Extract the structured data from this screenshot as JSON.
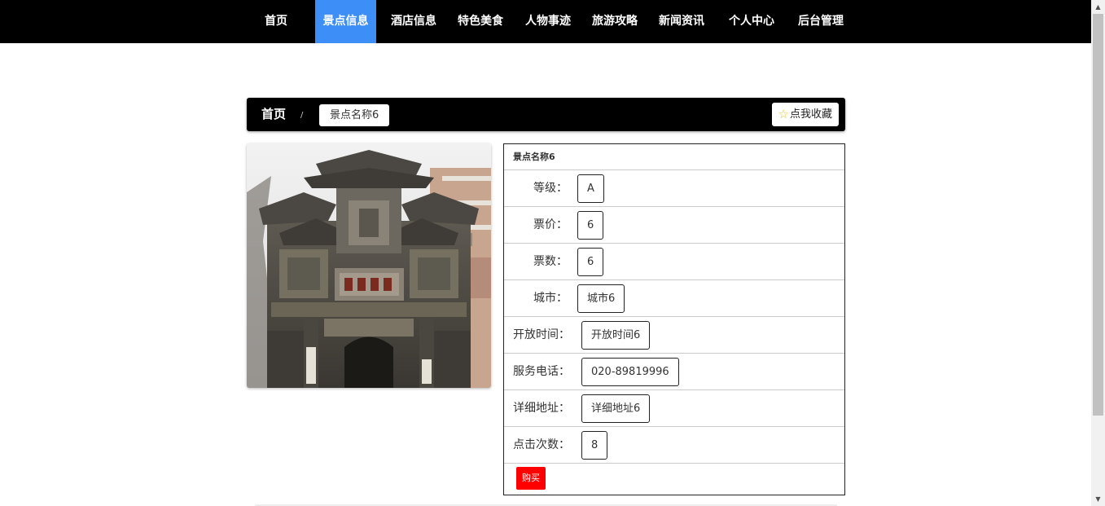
{
  "nav": {
    "items": [
      {
        "label": "首页",
        "active": false
      },
      {
        "label": "景点信息",
        "active": true
      },
      {
        "label": "酒店信息",
        "active": false
      },
      {
        "label": "特色美食",
        "active": false
      },
      {
        "label": "人物事迹",
        "active": false
      },
      {
        "label": "旅游攻略",
        "active": false
      },
      {
        "label": "新闻资讯",
        "active": false
      },
      {
        "label": "个人中心",
        "active": false
      },
      {
        "label": "后台管理",
        "active": false
      }
    ]
  },
  "breadcrumb": {
    "home": "首页",
    "separator": "/",
    "current": "景点名称6"
  },
  "favorite": {
    "icon": "star-outline-icon",
    "label": "点我收藏"
  },
  "detail": {
    "title": "景点名称6",
    "rows": [
      {
        "label": "等级：",
        "value": "A"
      },
      {
        "label": "票价：",
        "value": "6"
      },
      {
        "label": "票数：",
        "value": "6"
      },
      {
        "label": "城市：",
        "value": "城市6"
      },
      {
        "label": "开放时间：",
        "value": "开放时间6"
      },
      {
        "label": "服务电话：",
        "value": "020-89819996"
      },
      {
        "label": "详细地址：",
        "value": "详细地址6"
      },
      {
        "label": "点击次数：",
        "value": "8"
      }
    ],
    "buy_label": "购买"
  },
  "colors": {
    "nav_bg": "#000000",
    "nav_active": "#3e8ef7",
    "buy_button": "#ff0000",
    "star": "#f5c518"
  }
}
